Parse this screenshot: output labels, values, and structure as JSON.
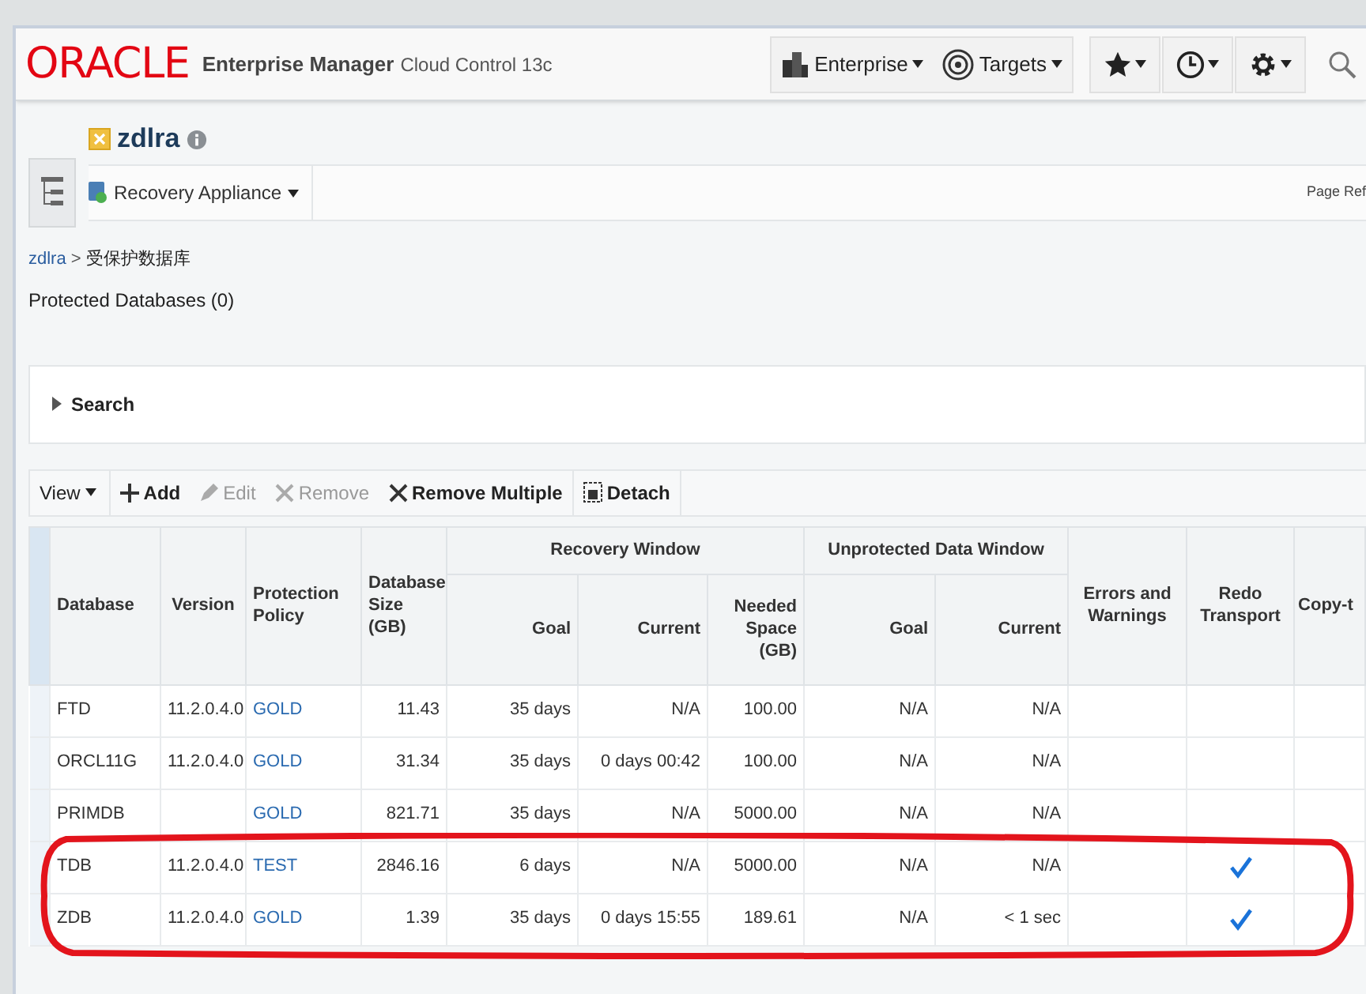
{
  "header": {
    "logo": "ORACLE",
    "product": "Enterprise Manager",
    "edition": "Cloud Control 13c",
    "menus": [
      {
        "label": "Enterprise"
      },
      {
        "label": "Targets"
      }
    ]
  },
  "target": {
    "name": "zdlra",
    "menu": "Recovery Appliance",
    "page_refresh": "Page Ref"
  },
  "breadcrumb": {
    "link": "zdlra",
    "separator": ">",
    "current": "受保护数据库"
  },
  "section_title": "Protected Databases (0)",
  "search": {
    "label": "Search",
    "expanded": false
  },
  "toolbar": [
    {
      "label": "View",
      "kind": "menu",
      "disabled": false
    },
    {
      "label": "Add",
      "kind": "add",
      "disabled": false
    },
    {
      "label": "Edit",
      "kind": "edit",
      "disabled": true
    },
    {
      "label": "Remove",
      "kind": "remove",
      "disabled": true
    },
    {
      "label": "Remove Multiple",
      "kind": "remove",
      "disabled": false
    },
    {
      "label": "Detach",
      "kind": "detach",
      "disabled": false
    }
  ],
  "table": {
    "groups": [
      "Recovery Window",
      "Unprotected Data Window"
    ],
    "columns": [
      "Database",
      "Version",
      "Protection Policy",
      "Database Size (GB)",
      "Goal",
      "Current",
      "Needed Space (GB)",
      "Goal",
      "Current",
      "Errors and Warnings",
      "Redo Transport",
      "Copy-t"
    ],
    "rows": [
      {
        "database": "FTD",
        "version": "11.2.0.4.0",
        "policy": "GOLD",
        "size": "11.43",
        "rw_goal": "35 days",
        "rw_current": "N/A",
        "needed": "100.00",
        "udw_goal": "N/A",
        "udw_current": "N/A",
        "redo_transport": false
      },
      {
        "database": "ORCL11G",
        "version": "11.2.0.4.0",
        "policy": "GOLD",
        "size": "31.34",
        "rw_goal": "35 days",
        "rw_current": "0 days 00:42",
        "needed": "100.00",
        "udw_goal": "N/A",
        "udw_current": "N/A",
        "redo_transport": false
      },
      {
        "database": "PRIMDB",
        "policy": "GOLD",
        "size": "821.71",
        "rw_goal": "35 days",
        "rw_current": "N/A",
        "needed": "5000.00",
        "udw_goal": "N/A",
        "udw_current": "N/A",
        "redo_transport": false
      },
      {
        "database": "TDB",
        "version": "11.2.0.4.0",
        "policy": "TEST",
        "size": "2846.16",
        "rw_goal": "6 days",
        "rw_current": "N/A",
        "needed": "5000.00",
        "udw_goal": "N/A",
        "udw_current": "N/A",
        "redo_transport": true
      },
      {
        "database": "ZDB",
        "version": "11.2.0.4.0",
        "policy": "GOLD",
        "size": "1.39",
        "rw_goal": "35 days",
        "rw_current": "0 days 15:55",
        "needed": "189.61",
        "udw_goal": "N/A",
        "udw_current": "< 1 sec",
        "redo_transport": true
      }
    ]
  }
}
